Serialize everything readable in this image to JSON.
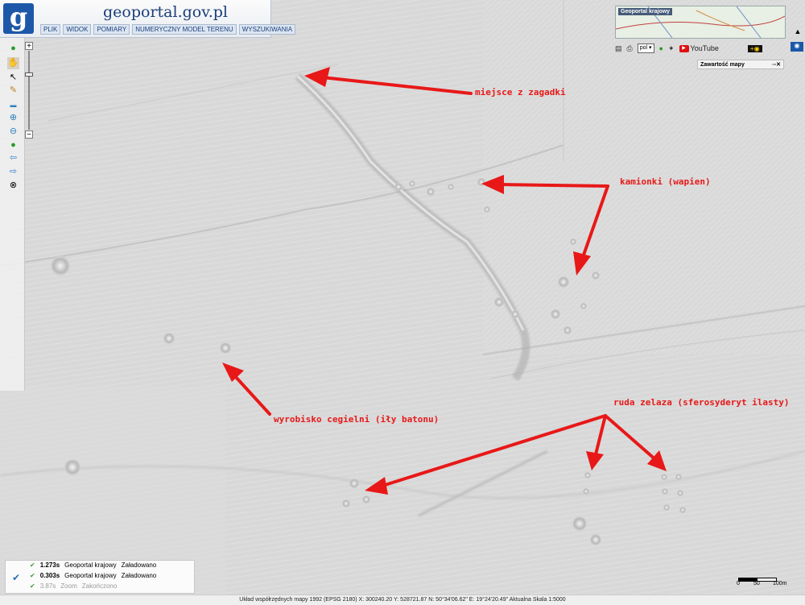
{
  "header": {
    "logo_letter": "g",
    "site_title": "geoportal.gov.pl",
    "menu": [
      "PLIK",
      "WIDOK",
      "POMIARY",
      "NUMERYCZNY MODEL TERENU",
      "WYSZUKIWANIA"
    ]
  },
  "top_right": {
    "minimap_label": "Geoportal krajowy",
    "language": "pol",
    "youtube_label": "YouTube",
    "layer_button": "Zawartość mapy"
  },
  "annotations": [
    {
      "text": "miejsce z zagadki"
    },
    {
      "text": "kamionki (wapien)"
    },
    {
      "text": "wyrobisko cegielni (iły batonu)"
    },
    {
      "text": "ruda zelaza (sferosyderyt ilasty)"
    }
  ],
  "status_panel": [
    {
      "time": "1.273s",
      "service": "Geoportal krajowy",
      "state": "Załadowano"
    },
    {
      "time": "0.303s",
      "service": "Geoportal krajowy",
      "state": "Załadowano"
    },
    {
      "time": "3.87s",
      "service": "Zoom",
      "state": "Zakończono"
    }
  ],
  "status_bar": "Układ współrzędnych mapy 1992 (EPSG 2180)   X: 300240.20  Y: 528721.87   N: 50°34'06.62\"  E: 19°24'20.49\"   Aktualna Skala 1:5000",
  "scalebar": {
    "labels": [
      "0",
      "50",
      "100m"
    ]
  },
  "colors": {
    "annotation": "#e81818",
    "header_blue": "#1d58a8"
  }
}
